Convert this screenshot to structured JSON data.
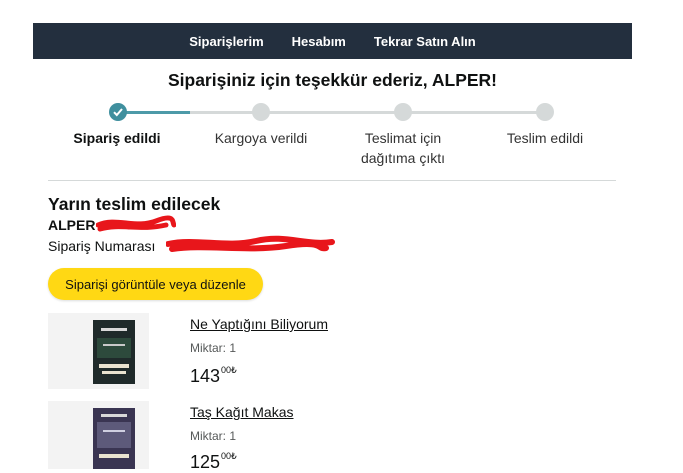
{
  "nav": {
    "orders": "Siparişlerim",
    "account": "Hesabım",
    "buy_again": "Tekrar Satın Alın"
  },
  "header": {
    "thanks": "Siparişiniz için teşekkür ederiz, ALPER!"
  },
  "progress": {
    "current_step": 1,
    "steps": [
      {
        "label": "Sipariş edildi"
      },
      {
        "label": "Kargoya verildi"
      },
      {
        "label_line1": "Teslimat için",
        "label_line2": "dağıtıma çıktı"
      },
      {
        "label": "Teslim edildi"
      }
    ]
  },
  "delivery": {
    "heading": "Yarın teslim edilecek",
    "customer_name": "ALPER -",
    "order_number_label": "Sipariş Numarası",
    "view_button": "Siparişi görüntüle veya düzenle"
  },
  "items": [
    {
      "title": "Ne Yaptığını Biliyorum",
      "qty": "Miktar: 1",
      "price_main": "143",
      "price_fraction": "00₺",
      "cover_author": "ALICE FEENEY"
    },
    {
      "title": "Taş Kağıt Makas",
      "qty": "Miktar: 1",
      "price_main": "125",
      "price_fraction": "00₺",
      "cover_author": "ALICE FEENEY"
    }
  ],
  "colors": {
    "nav_bg": "#232f3e",
    "button_yellow": "#ffd814",
    "progress_done": "#3f8f9e",
    "redaction": "#e8161b"
  }
}
